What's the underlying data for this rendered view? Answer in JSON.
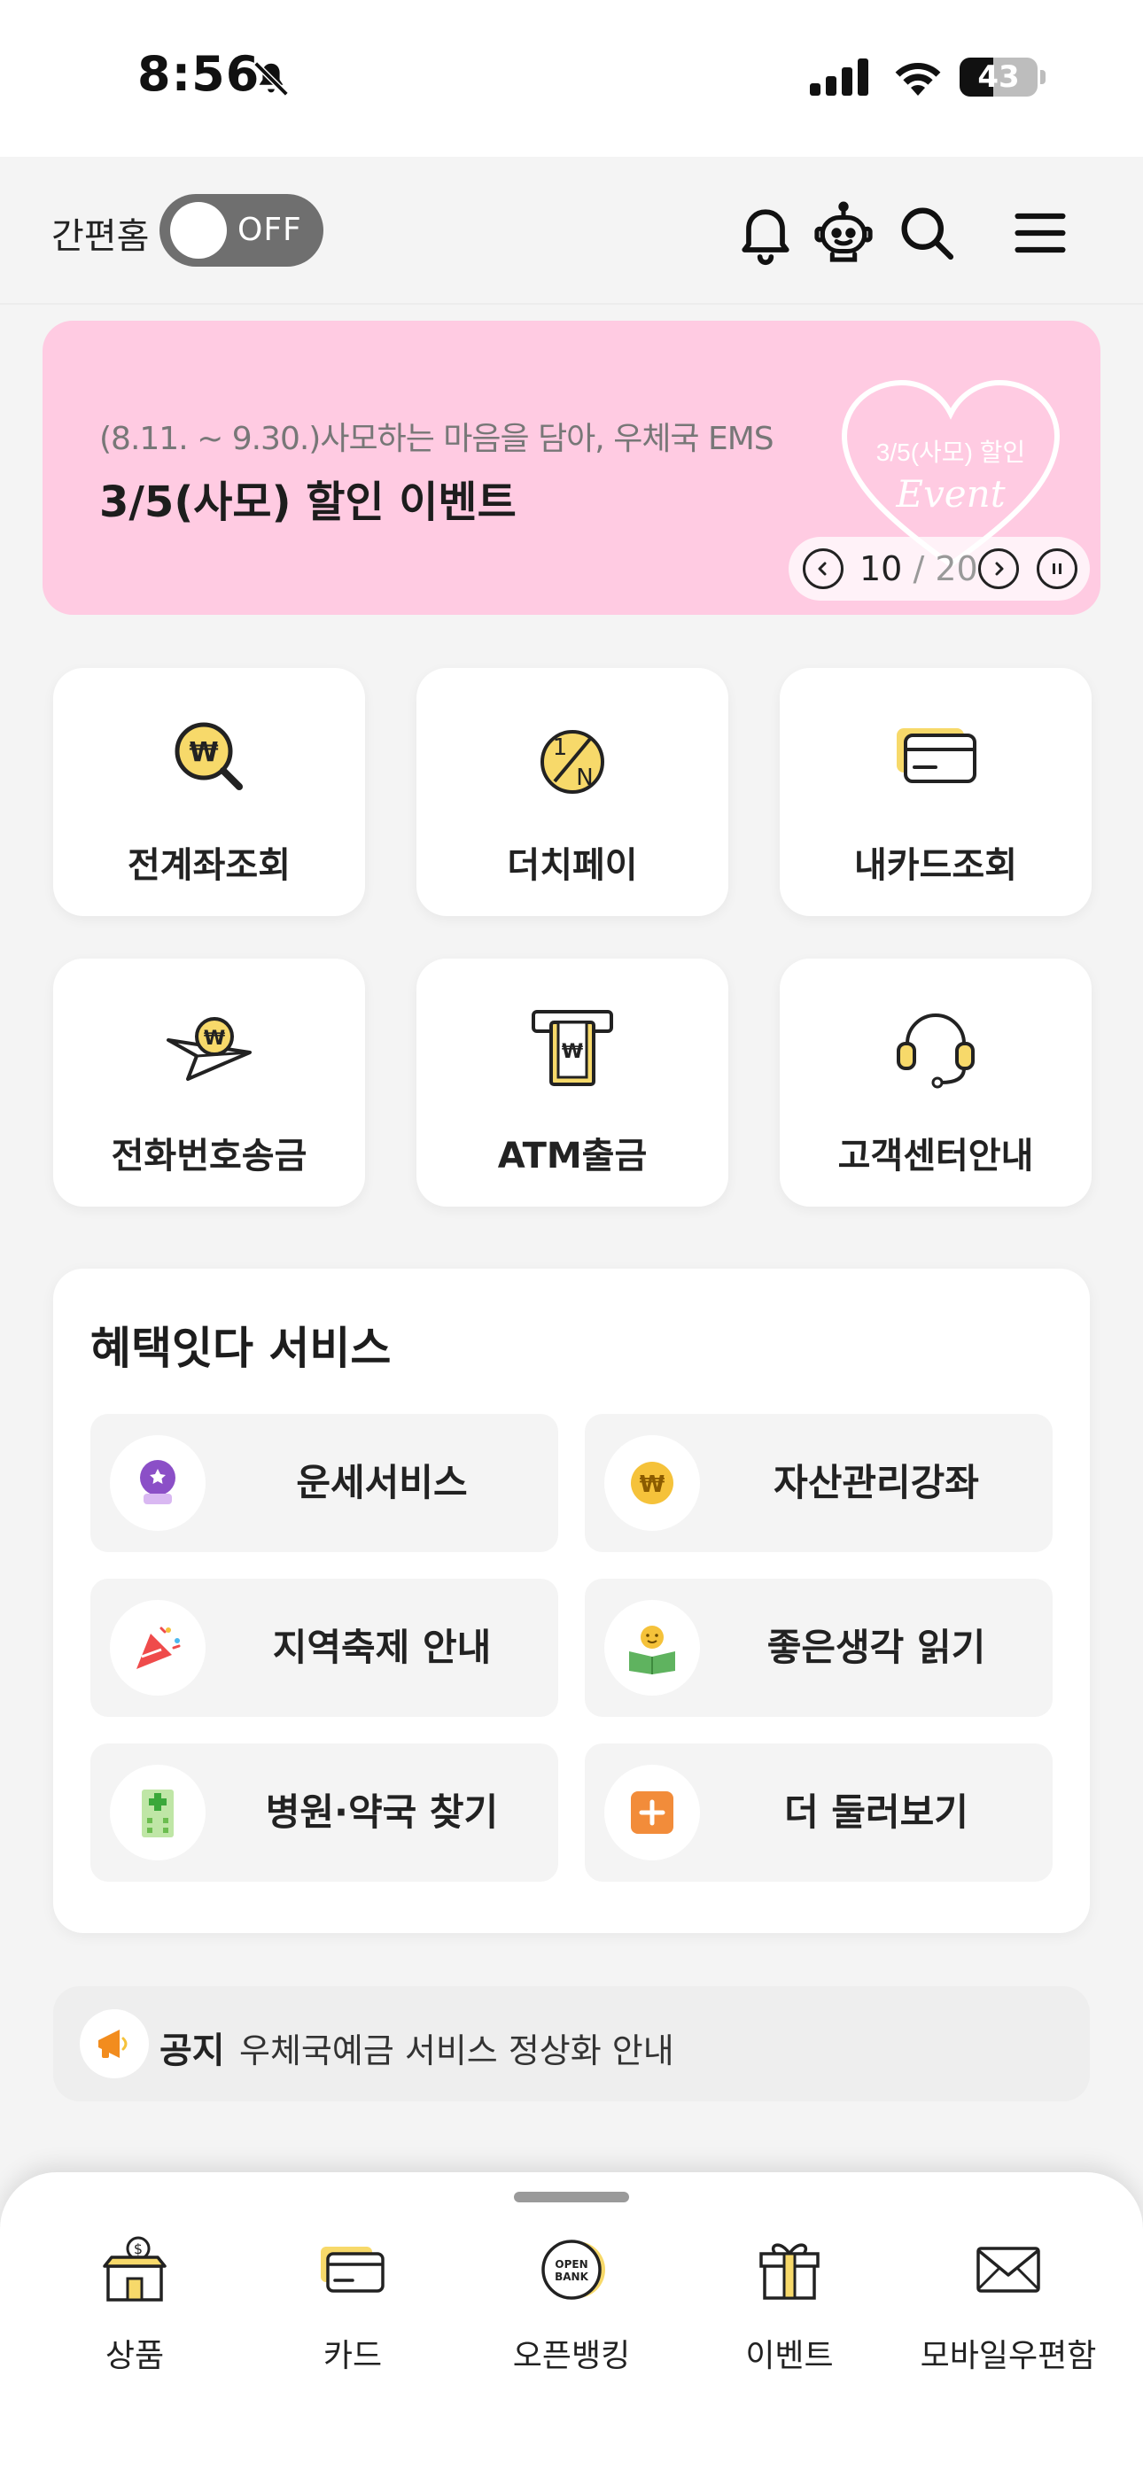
{
  "status_bar": {
    "time": "8:56",
    "battery_level": "43",
    "battery_fraction": 0.43
  },
  "header": {
    "simple_home_label": "간편홈",
    "toggle_text": "OFF",
    "icons": [
      "bell-icon",
      "chatbot-icon",
      "search-icon",
      "menu-icon"
    ]
  },
  "banner": {
    "subtitle": "(8.11. ~ 9.30.)사모하는 마음을 담아, 우체국 EMS",
    "title": "3/5(사모) 할인 이벤트",
    "heart_line1": "3/5(사모) 할인",
    "heart_line2": "Event",
    "page_current": "10",
    "page_separator": " / ",
    "page_total": "20",
    "background_color": "#ffcbe2"
  },
  "quick_menu": [
    {
      "label": "전계좌조회",
      "icon": "won-search-icon"
    },
    {
      "label": "더치페이",
      "icon": "dutch-pay-icon"
    },
    {
      "label": "내카드조회",
      "icon": "card-icon"
    },
    {
      "label": "전화번호송금",
      "icon": "paper-plane-won-icon"
    },
    {
      "label": "ATM출금",
      "icon": "atm-icon"
    },
    {
      "label": "고객센터안내",
      "icon": "headset-icon"
    }
  ],
  "benefit": {
    "title": "혜택잇다 서비스",
    "items": [
      {
        "label": "운세서비스",
        "icon": "crystal-ball-icon"
      },
      {
        "label": "자산관리강좌",
        "icon": "won-coin-icon"
      },
      {
        "label": "지역축제 안내",
        "icon": "party-popper-icon"
      },
      {
        "label": "좋은생각 읽기",
        "icon": "reading-book-icon"
      },
      {
        "label": "병원·약국 찾기",
        "icon": "hospital-icon"
      },
      {
        "label": "더 둘러보기",
        "icon": "plus-box-icon"
      }
    ]
  },
  "notice": {
    "label": "공지",
    "text": "우체국예금 서비스 정상화 안내"
  },
  "bottom_nav": [
    {
      "label": "상품",
      "icon": "store-icon"
    },
    {
      "label": "카드",
      "icon": "card-icon"
    },
    {
      "label": "오픈뱅킹",
      "icon": "open-bank-icon",
      "icon_text": "OPEN BANK"
    },
    {
      "label": "이벤트",
      "icon": "gift-icon"
    },
    {
      "label": "모바일우편함",
      "icon": "mail-icon"
    }
  ],
  "colors": {
    "accent_yellow": "#f7d96a",
    "toggle_off": "#6f6f6f",
    "background": "#f4f4f4"
  }
}
